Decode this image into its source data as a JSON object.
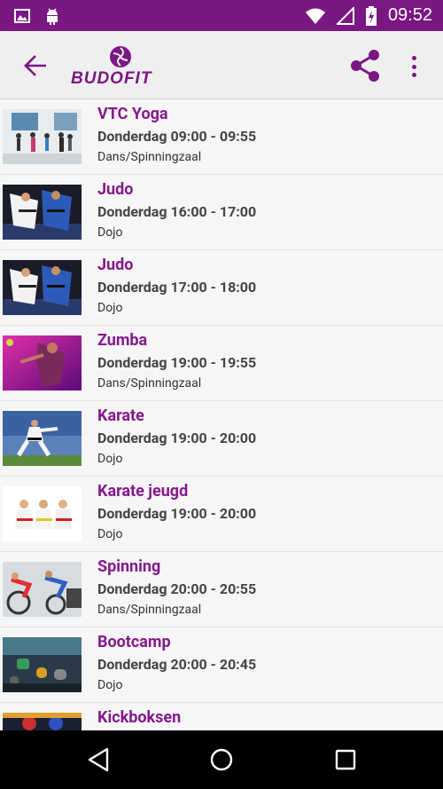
{
  "statusbar": {
    "time": "09:52"
  },
  "appbar": {
    "logo_text_a": "BUDO",
    "logo_text_b": "FIT"
  },
  "colors": {
    "accent": "#7b1783",
    "title": "#85198c"
  },
  "classes": [
    {
      "name": "VTC Yoga",
      "time": "Donderdag 09:00 - 09:55",
      "location": "Dans/Spinningzaal",
      "thumb": "yoga"
    },
    {
      "name": "Judo",
      "time": "Donderdag 16:00 - 17:00",
      "location": "Dojo",
      "thumb": "judo"
    },
    {
      "name": "Judo",
      "time": "Donderdag 17:00 - 18:00",
      "location": "Dojo",
      "thumb": "judo"
    },
    {
      "name": "Zumba",
      "time": "Donderdag 19:00 - 19:55",
      "location": "Dans/Spinningzaal",
      "thumb": "zumba"
    },
    {
      "name": "Karate",
      "time": "Donderdag 19:00 - 20:00",
      "location": "Dojo",
      "thumb": "karate"
    },
    {
      "name": "Karate jeugd",
      "time": "Donderdag 19:00 - 20:00",
      "location": "Dojo",
      "thumb": "kids"
    },
    {
      "name": "Spinning",
      "time": "Donderdag 20:00 - 20:55",
      "location": "Dans/Spinningzaal",
      "thumb": "spinning"
    },
    {
      "name": "Bootcamp",
      "time": "Donderdag 20:00 - 20:45",
      "location": "Dojo",
      "thumb": "bootcamp"
    },
    {
      "name": "Kickboksen",
      "time": "",
      "location": "",
      "thumb": "kickbox"
    }
  ]
}
